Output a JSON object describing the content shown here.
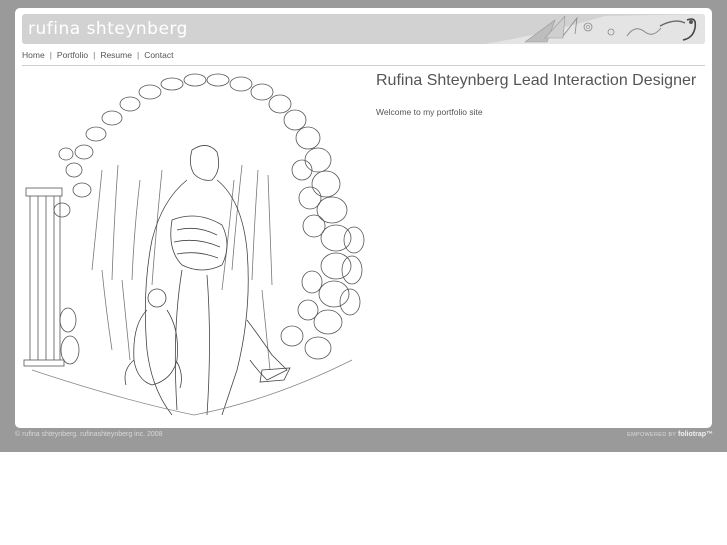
{
  "header": {
    "logo_text": "rufina shteynberg"
  },
  "nav": {
    "items": [
      {
        "label": "Home"
      },
      {
        "label": "Portfolio"
      },
      {
        "label": "Resume"
      },
      {
        "label": "Contact"
      }
    ],
    "separator": "|"
  },
  "main": {
    "title": "Rufina Shteynberg Lead Interaction Designer",
    "welcome": "Welcome to my portfolio site"
  },
  "footer": {
    "copyright": "© rufina shteynberg. rufinashteynberg inc. 2008",
    "powered_label": "EMPOWERED BY",
    "powered_brand": "foliotrap™"
  },
  "colors": {
    "page_band": "#9a9a9a",
    "header_bar": "#d2d2d2",
    "text": "#555555"
  }
}
